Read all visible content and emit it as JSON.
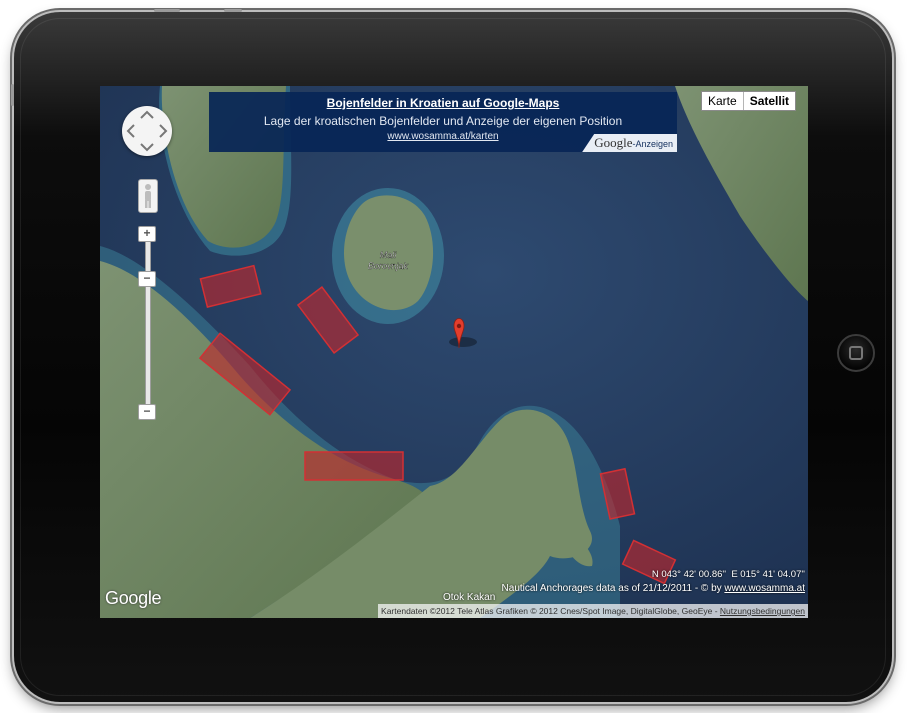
{
  "banner": {
    "title": "Bojenfelder in Kroatien auf Google-Maps",
    "subtitle": "Lage der kroatischen Bojenfelder und Anzeige der eigenen Position",
    "link": "www.wosamma.at/karten",
    "ads_google": "Google",
    "ads_label": "-Anzeigen"
  },
  "map_type": {
    "map_label": "Karte",
    "satellite_label": "Satellit",
    "selected": "Satellit"
  },
  "controls": {
    "zoom_in": "+",
    "zoom_out": "−",
    "zoom_mid": "−"
  },
  "map": {
    "label_mali": "Mali",
    "label_borovnjak": "Borovnjak",
    "label_kakan": "Otok Kakan"
  },
  "coordinates": {
    "lat": "N 043° 42' 00.86''",
    "lon": "E 015° 41' 04.07''"
  },
  "nautical": {
    "text": "Nautical Anchorages data as of 21/12/2011 - © by",
    "link": "www.wosamma.at"
  },
  "attribution": {
    "text": "Kartendaten ©2012 Tele Atlas  Grafiken © 2012 Cnes/Spot Image, DigitalGlobe, GeoEye -",
    "terms": "Nutzungsbedingungen"
  },
  "logo": "Google",
  "colors": {
    "banner_bg": "#08265a",
    "mooring_field": "#c0262c",
    "sea": "#2b4668",
    "land": "#6f8a5e"
  }
}
